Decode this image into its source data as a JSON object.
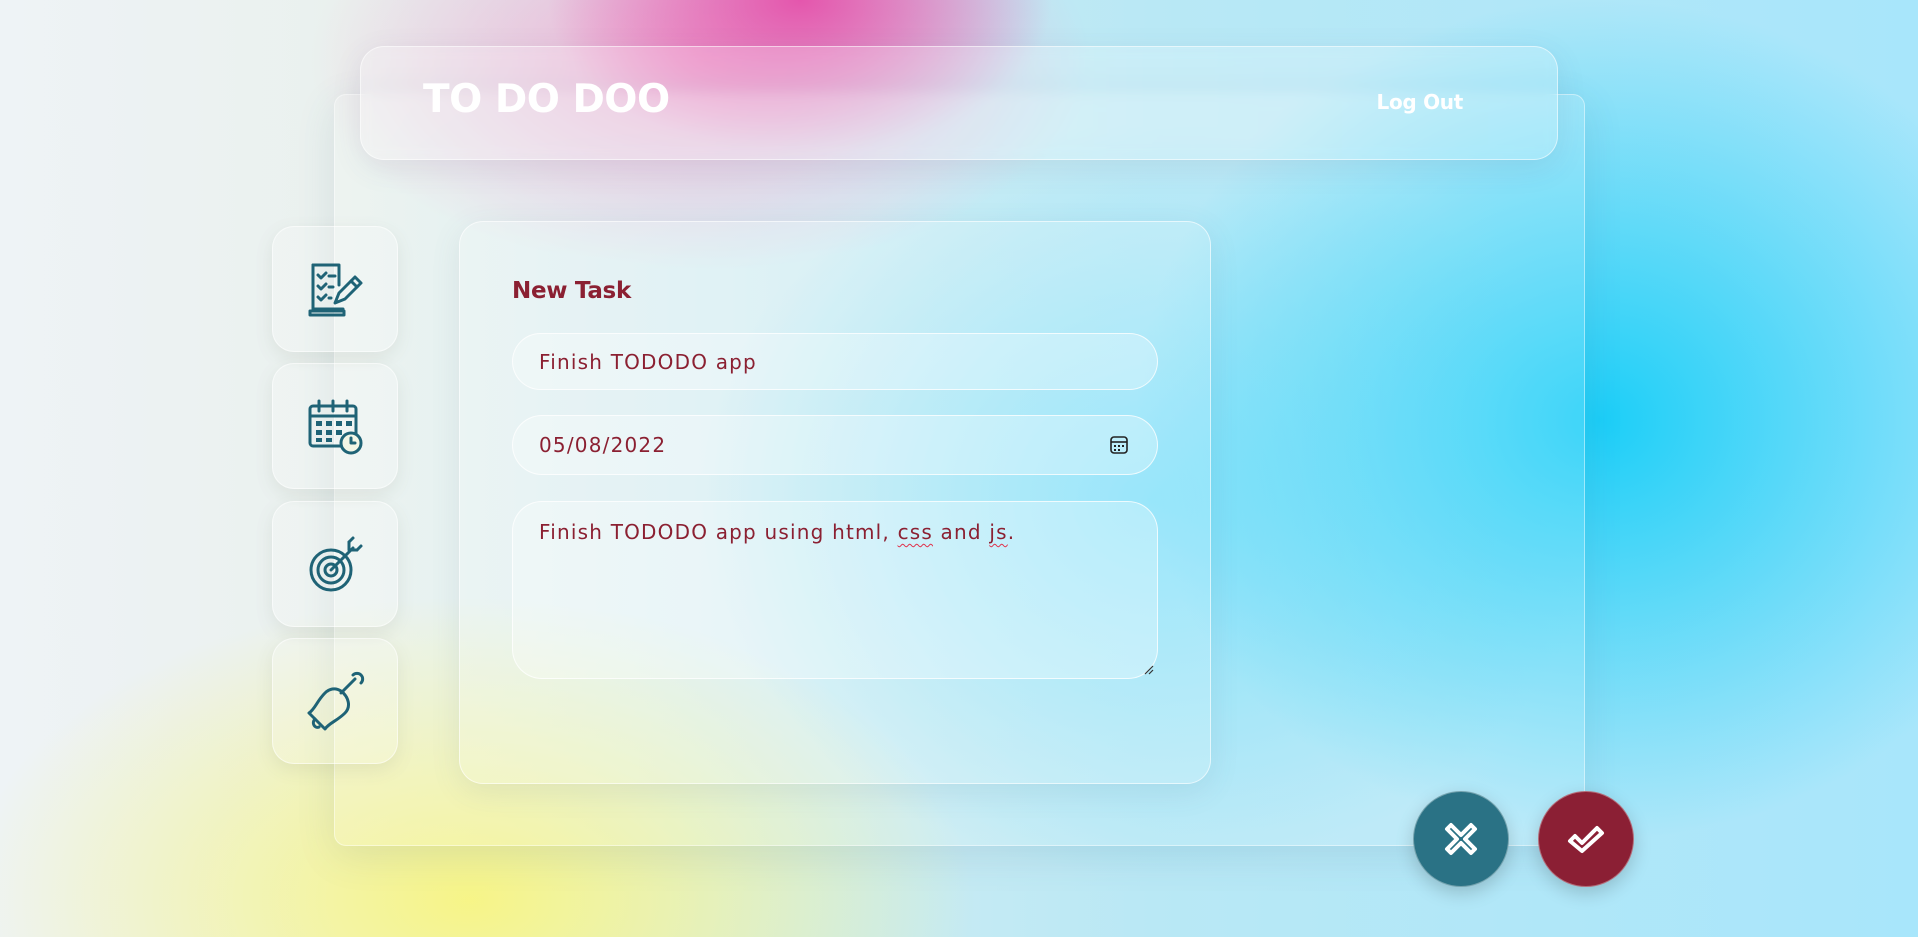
{
  "app": {
    "title": "TO DO DOO",
    "logout_label": "Log Out"
  },
  "sidebar": {
    "items": [
      {
        "name": "tasks",
        "icon": "checklist-pencil-icon"
      },
      {
        "name": "calendar",
        "icon": "calendar-clock-icon"
      },
      {
        "name": "goals",
        "icon": "target-arrow-icon"
      },
      {
        "name": "reminders",
        "icon": "bell-icon"
      }
    ]
  },
  "form": {
    "heading": "New Task",
    "title_value": "Finish TODODO app",
    "date_value": "05/08/2022",
    "description_prefix": "Finish TODODO app using html, ",
    "description_word1": "css",
    "description_mid": " and ",
    "description_word2": "js",
    "description_suffix": "."
  },
  "actions": {
    "cancel_icon": "close-icon",
    "confirm_icon": "checkmark-icon"
  },
  "colors": {
    "accent_teal": "#2a7285",
    "accent_maroon": "#8b1f34",
    "icon_color": "#1f6376",
    "text_color": "#8b2032"
  }
}
